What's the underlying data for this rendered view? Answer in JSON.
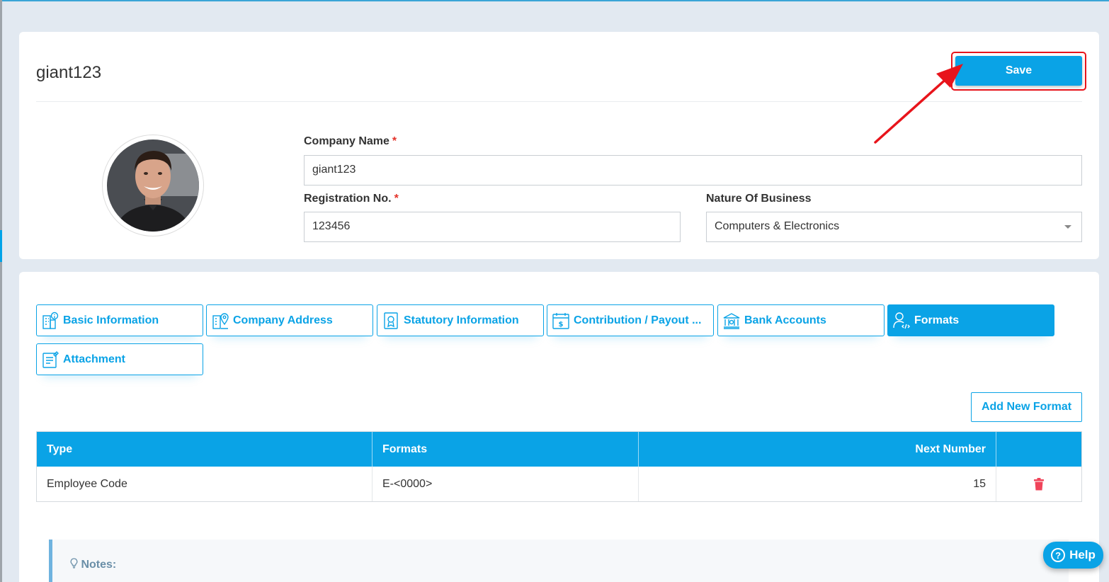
{
  "company": {
    "title": "giant123",
    "save_label": "Save"
  },
  "form": {
    "company_name": {
      "label": "Company Name",
      "required_mark": "*",
      "value": "giant123"
    },
    "registration_no": {
      "label": "Registration No.",
      "required_mark": "*",
      "value": "123456"
    },
    "nature_of_business": {
      "label": "Nature Of Business",
      "value": "Computers & Electronics"
    }
  },
  "tabs": [
    {
      "label": "Basic Information",
      "icon": "building-info-icon"
    },
    {
      "label": "Company Address",
      "icon": "building-location-icon"
    },
    {
      "label": "Statutory Information",
      "icon": "certificate-icon"
    },
    {
      "label": "Contribution / Payout ...",
      "icon": "payout-calendar-icon"
    },
    {
      "label": "Bank Accounts",
      "icon": "bank-icon"
    },
    {
      "label": "Formats",
      "icon": "user-code-icon",
      "active": true
    },
    {
      "label": "Attachment",
      "icon": "document-edit-icon"
    }
  ],
  "formats": {
    "add_label": "Add New Format",
    "columns": [
      "Type",
      "Formats",
      "Next Number",
      ""
    ],
    "rows": [
      {
        "type": "Employee Code",
        "format": "E-<0000>",
        "next_number": "15"
      }
    ]
  },
  "notes": {
    "label": "Notes:"
  },
  "help": {
    "label": "Help"
  },
  "colors": {
    "primary": "#0aa3e6",
    "danger": "#e8141b",
    "delete": "#f0445a"
  }
}
